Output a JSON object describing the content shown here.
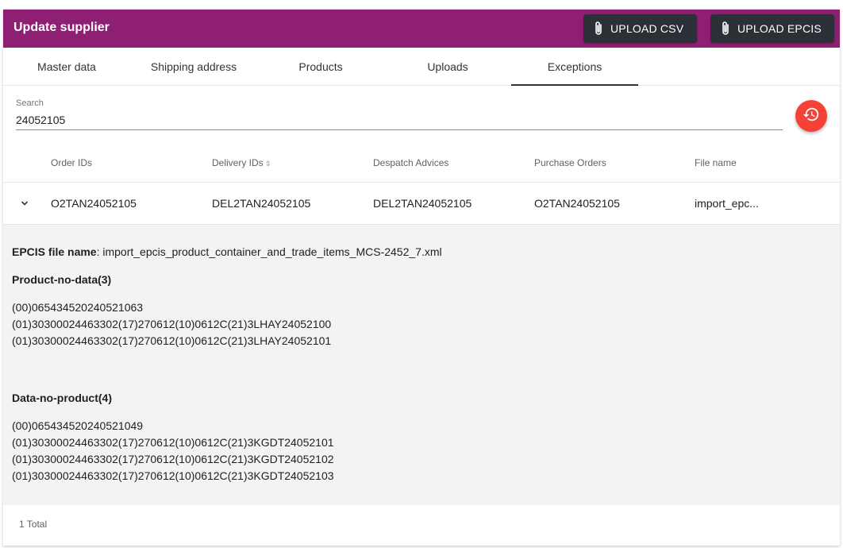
{
  "header": {
    "title": "Update supplier",
    "upload_csv_label": "UPLOAD CSV",
    "upload_epcis_label": "UPLOAD EPCIS",
    "bar_color": "#8e1f73",
    "button_color": "#2b2f36"
  },
  "tabs": [
    {
      "label": "Master data"
    },
    {
      "label": "Shipping address"
    },
    {
      "label": "Products"
    },
    {
      "label": "Uploads"
    },
    {
      "label": "Exceptions",
      "active": true
    }
  ],
  "search": {
    "label": "Search",
    "value": "24052105",
    "reset_icon": "history-icon",
    "reset_color": "#f44336"
  },
  "table": {
    "columns": [
      "Order IDs",
      "Delivery IDs",
      "Despatch Advices",
      "Purchase Orders",
      "File name"
    ],
    "sortable_column": "Delivery IDs",
    "rows": [
      {
        "order_ids": "O2TAN24052105",
        "delivery_ids": "DEL2TAN24052105",
        "despatch_advices": "DEL2TAN24052105",
        "purchase_orders": "O2TAN24052105",
        "file_name": "import_epc..."
      }
    ],
    "footer": "1 Total"
  },
  "detail": {
    "file_label": "EPCIS file name",
    "file_value": ": import_epcis_product_container_and_trade_items_MCS-2452_7.xml",
    "product_no_data_heading": "Product-no-data(3)",
    "product_no_data": [
      "(00)065434520240521063",
      "(01)30300024463302(17)270612(10)0612C(21)3LHAY24052100",
      "(01)30300024463302(17)270612(10)0612C(21)3LHAY24052101"
    ],
    "data_no_product_heading": "Data-no-product(4)",
    "data_no_product": [
      "(00)065434520240521049",
      "(01)30300024463302(17)270612(10)0612C(21)3KGDT24052101",
      "(01)30300024463302(17)270612(10)0612C(21)3KGDT24052102",
      "(01)30300024463302(17)270612(10)0612C(21)3KGDT24052103"
    ]
  }
}
